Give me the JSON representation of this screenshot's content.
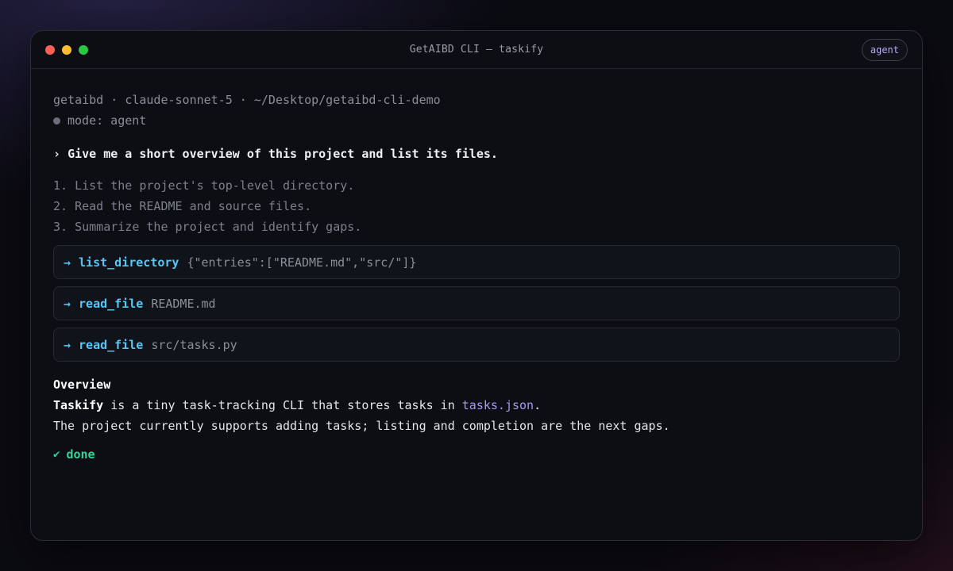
{
  "window": {
    "title": "GetAIBD CLI — taskify",
    "mode_badge": "agent"
  },
  "session": {
    "app": "getaibd",
    "model": "claude-sonnet-5",
    "path": "~/Desktop/getaibd-cli-demo",
    "separator": " · ",
    "mode_label": "mode: agent"
  },
  "prompt": {
    "marker": "›",
    "text": "Give me a short overview of this project and list its files."
  },
  "plan": [
    "1. List the project's top-level directory.",
    "2. Read the README and source files.",
    "3. Summarize the project and identify gaps."
  ],
  "tool_calls": [
    {
      "arrow": "→",
      "name": "list_directory",
      "arg": "{\"entries\":[\"README.md\",\"src/\"]}"
    },
    {
      "arrow": "→",
      "name": "read_file",
      "arg": "README.md"
    },
    {
      "arrow": "→",
      "name": "read_file",
      "arg": "src/tasks.py"
    }
  ],
  "overview": {
    "heading": "Overview",
    "line1_bold": "Taskify",
    "line1_mid": " is a tiny task-tracking CLI that stores tasks in ",
    "line1_code": "tasks.json",
    "line1_end": ".",
    "line2": "The project currently supports adding tasks; listing and completion are the next gaps."
  },
  "status": {
    "icon": "✔",
    "label": "done"
  },
  "colors": {
    "accent_tool": "#56c6f5",
    "accent_code": "#a897f5",
    "success": "#34d399",
    "badge": "#b7a8f5"
  }
}
